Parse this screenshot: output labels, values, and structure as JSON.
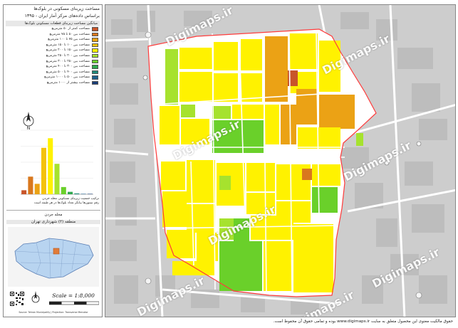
{
  "sidebar": {
    "title_line1": "مساحت زیربنای مسکونی در بلوک‌ها",
    "title_line2": "براساس داده‌های مرکز آمار ایران - ۱۳۹۵",
    "legend_header": "میانگین مساحت زیربنای قطعات مسکونی بلوک‌ها",
    "legend": [
      {
        "label": "مساحت کمتر از ۵۰ مترمربع",
        "color": "#c8552a"
      },
      {
        "label": "مساحت بین ۵۰ تا ۷۵ مترمربع",
        "color": "#d9781e"
      },
      {
        "label": "مساحت بین ۷۵ تا ۱۰۰ مترمربع",
        "color": "#eba215"
      },
      {
        "label": "مساحت بین ۱۰۰ تا ۱۵۰ مترمربع",
        "color": "#f4c20a"
      },
      {
        "label": "مساحت بین ۱۵۰ تا ۲۰۰ مترمربع",
        "color": "#fff200"
      },
      {
        "label": "مساحت بین ۲۰۰ تا ۲۵۰ مترمربع",
        "color": "#a6e22e"
      },
      {
        "label": "مساحت بین ۲۵۰ تا ۳۰۰ مترمربع",
        "color": "#6ad02a"
      },
      {
        "label": "مساحت بین ۳۰۰ تا ۴۰۰ مترمربع",
        "color": "#2fa84f"
      },
      {
        "label": "مساحت بین ۴۰۰ تا ۵۰۰ مترمربع",
        "color": "#1f8a7a"
      },
      {
        "label": "مساحت بین ۵۰۰ تا ۱۰۰۰ مترمربع",
        "color": "#1c5f8c"
      },
      {
        "label": "مساحت بیشتر از ۱۰۰۰ مترمربع",
        "color": "#1a3f7a"
      }
    ],
    "rose_label": "N",
    "chart_caption_line1": "ترکیب جمعیت زیربنای مسکونی محله جردن",
    "chart_caption_line2": "رقم ستون‌ها بیانگر تعداد بلوک‌ها در هر طبقه است",
    "district_head": "محله جردن",
    "district_sub": "منطقه (۳) شهرداری تهران",
    "scale_text": "Scale = 1:8,000",
    "footer_text": "Source: Tehran Municipality | Projection: Transverse Mercator"
  },
  "chart_data": {
    "type": "bar",
    "categories": [
      "<50",
      "50-75",
      "75-100",
      "100-150",
      "150-200",
      "200-250",
      "250-300",
      "300-400",
      "400-500",
      "500-1000",
      ">1000"
    ],
    "values": [
      5,
      22,
      13,
      58,
      70,
      38,
      9,
      3,
      1,
      0.5,
      0.5
    ],
    "colors": [
      "#c8552a",
      "#d9781e",
      "#eba215",
      "#f4c20a",
      "#fff200",
      "#a6e22e",
      "#6ad02a",
      "#2fa84f",
      "#1f8a7a",
      "#1c5f8c",
      "#1a3f7a"
    ],
    "ylim": [
      0,
      80
    ],
    "title": "",
    "xlabel": "",
    "ylabel": ""
  },
  "map": {
    "watermarks": [
      "Digimaps.ir",
      "Digimaps.ir",
      "Digimaps.ir",
      "Digimaps.ir",
      "Digimaps.ir",
      "Digimaps.ir",
      "Digimaps.ir",
      "Digimaps.ir"
    ],
    "boundary_color": "#ff3b3b"
  },
  "footer": {
    "copyright": "حقوق مالکیت معنوی این محصول متعلق به سایت www.digimaps.ir بوده و تمامی حقوق آن محفوظ است."
  }
}
